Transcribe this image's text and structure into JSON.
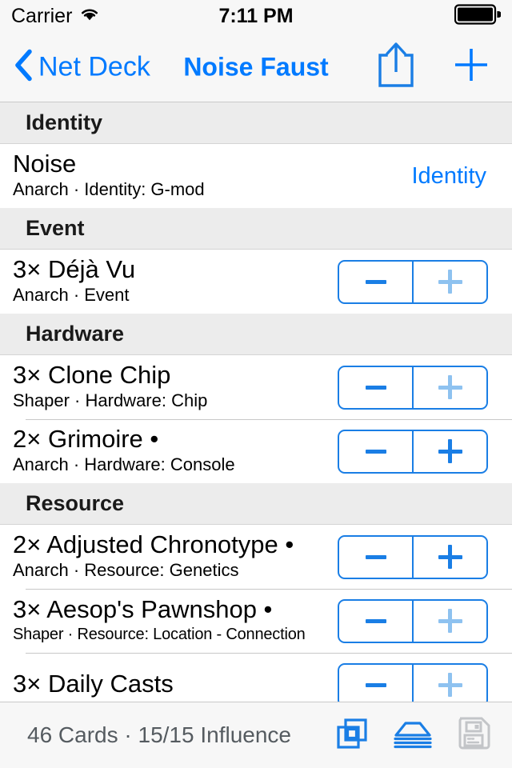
{
  "status_bar": {
    "carrier": "Carrier",
    "wifi_icon": "wifi-icon",
    "time": "7:11 PM",
    "battery_icon": "battery-full-icon"
  },
  "nav_bar": {
    "back_icon": "chevron-left-icon",
    "back_label": "Net Deck",
    "title": "Noise Faust",
    "share_icon": "share-icon",
    "add_icon": "plus-icon"
  },
  "colors": {
    "accent": "#007AFF",
    "stepper_border": "#1A7EE5",
    "stepper_disabled": "#8EC2F0",
    "section_header_bg": "#ECECEC",
    "chrome_bg": "#F7F7F7",
    "toolbar_text": "#555B60",
    "disabled_icon": "#C7C7CC"
  },
  "sections": [
    {
      "title": "Identity",
      "rows": [
        {
          "title": "Noise",
          "subtitle": "Anarch · Identity: G-mod",
          "accessory_type": "text",
          "accessory_label": "Identity"
        }
      ]
    },
    {
      "title": "Event",
      "rows": [
        {
          "title": "3× Déjà Vu",
          "subtitle": "Anarch · Event",
          "accessory_type": "stepper",
          "minus_enabled": true,
          "plus_enabled": false
        }
      ]
    },
    {
      "title": "Hardware",
      "rows": [
        {
          "title": "3× Clone Chip",
          "subtitle": "Shaper · Hardware: Chip",
          "accessory_type": "stepper",
          "minus_enabled": true,
          "plus_enabled": false
        },
        {
          "title": "2× Grimoire •",
          "subtitle": "Anarch · Hardware: Console",
          "accessory_type": "stepper",
          "minus_enabled": true,
          "plus_enabled": true
        }
      ]
    },
    {
      "title": "Resource",
      "rows": [
        {
          "title": "2× Adjusted Chronotype •",
          "subtitle": "Anarch · Resource: Genetics",
          "accessory_type": "stepper",
          "minus_enabled": true,
          "plus_enabled": true
        },
        {
          "title": "3× Aesop's Pawnshop •",
          "subtitle": "Shaper · Resource: Location - Connection",
          "subtitle_shrink": true,
          "accessory_type": "stepper",
          "minus_enabled": true,
          "plus_enabled": false
        },
        {
          "title": "3× Daily Casts",
          "subtitle": "",
          "accessory_type": "stepper",
          "minus_enabled": true,
          "plus_enabled": false,
          "clipped": true
        }
      ]
    }
  ],
  "toolbar": {
    "status": "46 Cards · 15/15 Influence",
    "buttons": [
      {
        "icon": "copy-cards-icon",
        "enabled": true
      },
      {
        "icon": "deck-stack-icon",
        "enabled": true
      },
      {
        "icon": "save-floppy-icon",
        "enabled": false
      }
    ]
  }
}
